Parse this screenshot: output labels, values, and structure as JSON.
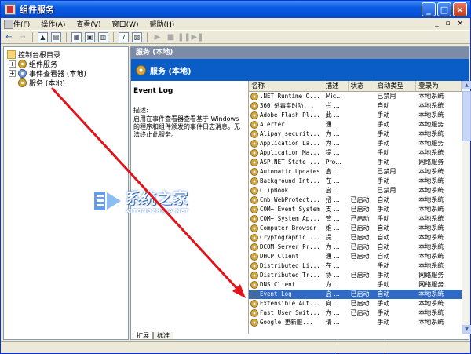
{
  "window": {
    "title": "组件服务",
    "controls": {
      "minimize": "_",
      "maximize": "□",
      "close": "×"
    }
  },
  "menu": [
    "文件(F)",
    "操作(A)",
    "查看(V)",
    "窗口(W)",
    "帮助(H)"
  ],
  "menu_winctl": "_ ▫ ×",
  "toolbar": {
    "back": "←",
    "forward": "→",
    "buttons": [
      "up-icon",
      "show-tree-icon",
      "properties-icon",
      "export-icon",
      "view-icon",
      "help-icon",
      "console-icon",
      "play-icon",
      "stop-icon",
      "pause-icon",
      "restart-icon"
    ]
  },
  "tree": {
    "root": "控制台根目录",
    "items": [
      {
        "label": "组件服务",
        "expander": "+"
      },
      {
        "label": "事件查看器 (本地)",
        "expander": "+"
      },
      {
        "label": "服务 (本地)",
        "expander": ""
      }
    ]
  },
  "right": {
    "header": "服务 (本地)",
    "banner": "服务 (本地)",
    "desc_name": "Event Log",
    "desc_label": "描述:",
    "desc_text": "启用在事件查看器查看基于 Windows 的程序和组件颁发的事件日志消息。无法终止此服务。",
    "columns": [
      "名称",
      "描述",
      "状态",
      "启动类型",
      "登录为"
    ],
    "rows": [
      [
        ".NET Runtime O...",
        "Mic...",
        "",
        "已禁用",
        "本地系统"
      ],
      [
        "360 杀毒实时防...",
        "拦 ...",
        "",
        "自动",
        "本地系统"
      ],
      [
        "Adobe Flash Pl...",
        "此 ...",
        "",
        "手动",
        "本地系统"
      ],
      [
        "Alerter",
        "通 ...",
        "",
        "手动",
        "本地服务"
      ],
      [
        "Alipay securit...",
        "为 ...",
        "",
        "手动",
        "本地系统"
      ],
      [
        "Application La...",
        "为 ...",
        "",
        "手动",
        "本地服务"
      ],
      [
        "Application Ma...",
        "提 ...",
        "",
        "手动",
        "本地系统"
      ],
      [
        "ASP.NET State ...",
        "Pro...",
        "",
        "手动",
        "网络服务"
      ],
      [
        "Automatic Updates",
        "启 ...",
        "",
        "已禁用",
        "本地系统"
      ],
      [
        "Background Int...",
        "在 ...",
        "",
        "手动",
        "本地系统"
      ],
      [
        "ClipBook",
        "启 ...",
        "",
        "已禁用",
        "本地系统"
      ],
      [
        "Cmb WebProtect...",
        "招 ...",
        "已启动",
        "自动",
        "本地系统"
      ],
      [
        "COM+ Event System",
        "支 ...",
        "已启动",
        "手动",
        "本地系统"
      ],
      [
        "COM+ System Ap...",
        "管 ...",
        "已启动",
        "手动",
        "本地系统"
      ],
      [
        "Computer Browser",
        "维 ...",
        "已启动",
        "自动",
        "本地系统"
      ],
      [
        "Cryptographic ...",
        "提 ...",
        "已启动",
        "自动",
        "本地系统"
      ],
      [
        "DCOM Server Pr...",
        "为 ...",
        "已启动",
        "自动",
        "本地系统"
      ],
      [
        "DHCP Client",
        "通 ...",
        "已启动",
        "自动",
        "本地系统"
      ],
      [
        "Distributed Li...",
        "在 ...",
        "",
        "手动",
        "本地系统"
      ],
      [
        "Distributed Tr...",
        "协 ...",
        "已启动",
        "手动",
        "网络服务"
      ],
      [
        "DNS Client",
        "为 ...",
        "",
        "手动",
        "网络服务"
      ],
      [
        "Event Log",
        "启 ...",
        "已启动",
        "自动",
        "本地系统"
      ],
      [
        "Extensible Aut...",
        "向 ...",
        "已启动",
        "手动",
        "本地系统"
      ],
      [
        "Fast User Swit...",
        "为 ...",
        "已启动",
        "手动",
        "本地系统"
      ],
      [
        "Google 更新服...",
        "请 ...",
        "",
        "手动",
        "本地系统"
      ]
    ],
    "selected_row": 21,
    "tabs": [
      "扩展",
      "标准"
    ]
  },
  "watermark": {
    "cn": "系统之家",
    "en": "XITONGZHIJIA.NET"
  },
  "colors": {
    "titlebar": "#0450D9",
    "banner": "#0A5CC6",
    "selection": "#316AC5",
    "arrow": "#E0141A"
  }
}
